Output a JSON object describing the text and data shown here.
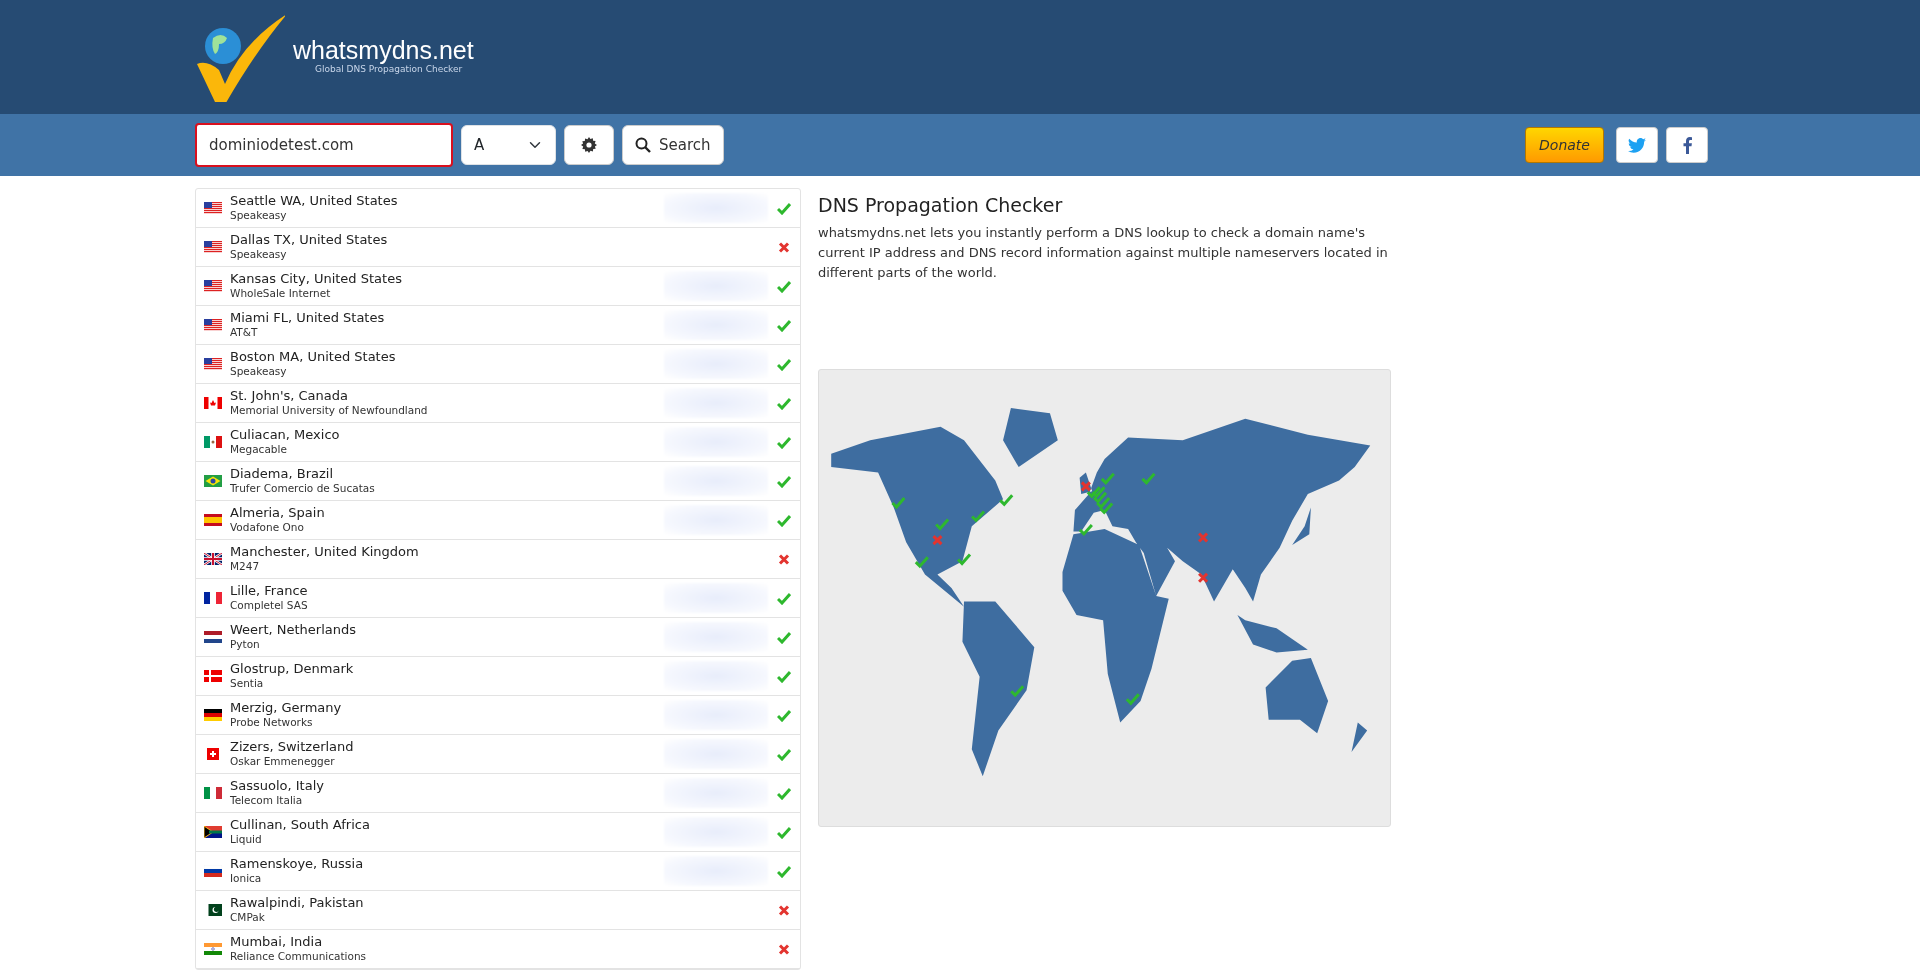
{
  "header": {
    "logo_text": "whatsmydns.net",
    "tagline": "Global DNS Propagation Checker"
  },
  "search": {
    "value": "dominiodetest.com",
    "record_type": "A",
    "button": "Search"
  },
  "actions": {
    "donate": "Donate"
  },
  "results": [
    {
      "city": "Seattle WA, United States",
      "provider": "Speakeasy",
      "kind": "us",
      "ok": true
    },
    {
      "city": "Dallas TX, United States",
      "provider": "Speakeasy",
      "kind": "us",
      "ok": false
    },
    {
      "city": "Kansas City, United States",
      "provider": "WholeSale Internet",
      "kind": "us",
      "ok": true
    },
    {
      "city": "Miami FL, United States",
      "provider": "AT&T",
      "kind": "us",
      "ok": true
    },
    {
      "city": "Boston MA, United States",
      "provider": "Speakeasy",
      "kind": "us",
      "ok": true
    },
    {
      "city": "St. John's, Canada",
      "provider": "Memorial University of Newfoundland",
      "kind": "ca",
      "ok": true
    },
    {
      "city": "Culiacan, Mexico",
      "provider": "Megacable",
      "kind": "mx",
      "ok": true
    },
    {
      "city": "Diadema, Brazil",
      "provider": "Trufer Comercio de Sucatas",
      "kind": "br",
      "ok": true
    },
    {
      "city": "Almeria, Spain",
      "provider": "Vodafone Ono",
      "kind": "es",
      "ok": true
    },
    {
      "city": "Manchester, United Kingdom",
      "provider": "M247",
      "kind": "gb",
      "ok": false
    },
    {
      "city": "Lille, France",
      "provider": "Completel SAS",
      "kind": "fr",
      "ok": true
    },
    {
      "city": "Weert, Netherlands",
      "provider": "Pyton",
      "kind": "nl",
      "ok": true
    },
    {
      "city": "Glostrup, Denmark",
      "provider": "Sentia",
      "kind": "dk",
      "ok": true
    },
    {
      "city": "Merzig, Germany",
      "provider": "Probe Networks",
      "kind": "de",
      "ok": true
    },
    {
      "city": "Zizers, Switzerland",
      "provider": "Oskar Emmenegger",
      "kind": "ch",
      "ok": true
    },
    {
      "city": "Sassuolo, Italy",
      "provider": "Telecom Italia",
      "kind": "it",
      "ok": true
    },
    {
      "city": "Cullinan, South Africa",
      "provider": "Liquid",
      "kind": "za",
      "ok": true
    },
    {
      "city": "Ramenskoye, Russia",
      "provider": "Ionica",
      "kind": "ru",
      "ok": true
    },
    {
      "city": "Rawalpindi, Pakistan",
      "provider": "CMPak",
      "kind": "pk",
      "ok": false
    },
    {
      "city": "Mumbai, India",
      "provider": "Reliance Communications",
      "kind": "in",
      "ok": false
    }
  ],
  "info": {
    "title": "DNS Propagation Checker",
    "text": "whatsmydns.net lets you instantly perform a DNS lookup to check a domain name's current IP address and DNS record information against multiple nameservers located in different parts of the world."
  }
}
